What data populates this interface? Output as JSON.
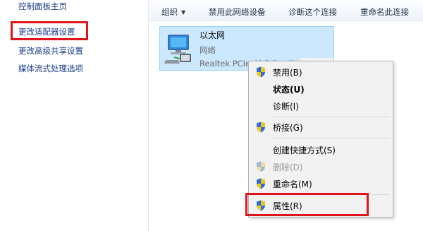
{
  "left_pane": {
    "links": [
      {
        "label": "控制面板主页"
      },
      {
        "label": "更改适配器设置"
      },
      {
        "label": "更改高级共享设置"
      },
      {
        "label": "媒体流式处理选项"
      }
    ],
    "highlight_color": "#e0141c"
  },
  "toolbar": {
    "organize_label": "组织",
    "organize_caret": "▼",
    "disable_label": "禁用此网络设备",
    "diagnose_label": "诊断这个连接",
    "rename_label": "重命名此连接"
  },
  "connection": {
    "name": "以太网",
    "status": "网络",
    "device": "Realtek PCIe GbE Family Controller",
    "icon": "network-adapter-icon",
    "selection_color": "#cce8ff"
  },
  "context_menu": {
    "items": [
      {
        "label": "禁用(B)",
        "icon": "shield-icon"
      },
      {
        "label": "状态(U)"
      },
      {
        "label": "诊断(I)"
      },
      {
        "label": "桥接(G)",
        "icon": "shield-icon"
      },
      {
        "label": "创建快捷方式(S)"
      },
      {
        "label": "删除(D)",
        "icon": "shield-icon",
        "disabled": true
      },
      {
        "label": "重命名(M)",
        "icon": "shield-icon"
      },
      {
        "label": "属性(R)",
        "icon": "shield-icon"
      }
    ]
  }
}
